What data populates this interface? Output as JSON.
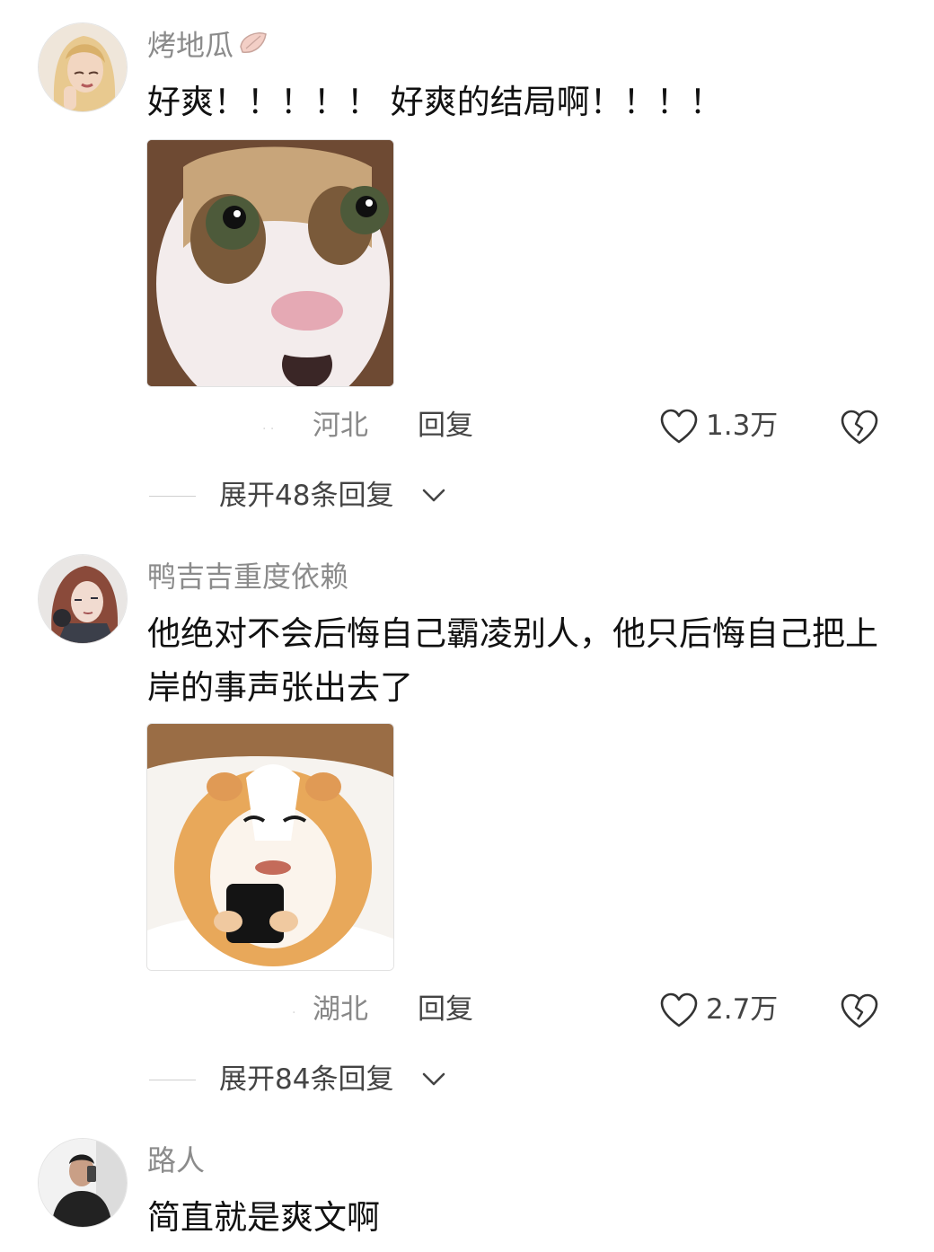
{
  "comments": [
    {
      "username": "烤地瓜",
      "badge_icon": "shell-emoji-icon",
      "text": "好爽！！！！！ 好爽的结局啊！！！！",
      "sticker_icon": "surprised-cat-sticker",
      "region": "河北",
      "reply_label": "回复",
      "like_count": "1.3万",
      "expand_label": "展开48条回复"
    },
    {
      "username": "鸭吉吉重度依赖",
      "text": "他绝对不会后悔自己霸凌别人，他只后悔自己把上岸的事声张出去了",
      "sticker_icon": "hamster-phone-sticker",
      "region": "湖北",
      "reply_label": "回复",
      "like_count": "2.7万",
      "expand_label": "展开84条回复"
    },
    {
      "username": "路人",
      "text": "简直就是爽文啊"
    }
  ],
  "colors": {
    "username": "#8b8b8b",
    "text": "#111111",
    "meta": "#444444"
  }
}
